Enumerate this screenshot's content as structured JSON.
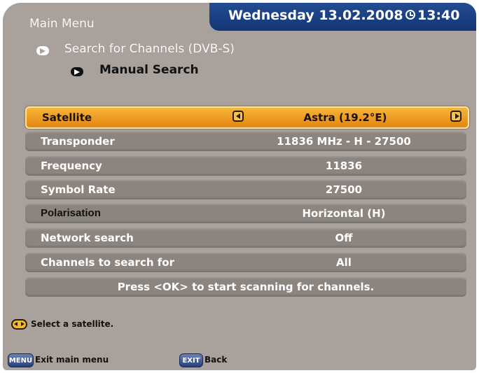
{
  "header": {
    "day": "Wednesday",
    "date": "13.02.2008",
    "time": "13:40"
  },
  "breadcrumb": {
    "level1": "Main Menu",
    "level2": "Search for Channels (DVB-S)",
    "level3": "Manual Search"
  },
  "settings": {
    "satellite": {
      "label": "Satellite",
      "value": "Astra (19.2°E)"
    },
    "transponder": {
      "label": "Transponder",
      "value": "11836 MHz - H - 27500"
    },
    "frequency": {
      "label": "Frequency",
      "value": "11836"
    },
    "symbol_rate": {
      "label": "Symbol Rate",
      "value": "27500"
    },
    "polarisation": {
      "label": "Polarisation",
      "value": "Horizontal (H)"
    },
    "network_search": {
      "label": "Network search",
      "value": "Off"
    },
    "channels": {
      "label": "Channels to search for",
      "value": "All"
    }
  },
  "start_hint": "Press <OK> to start scanning for channels.",
  "hint": "Select a satellite.",
  "footer": {
    "menu_key": "MENU",
    "menu_label": "Exit main menu",
    "exit_key": "EXIT",
    "exit_label": "Back"
  }
}
